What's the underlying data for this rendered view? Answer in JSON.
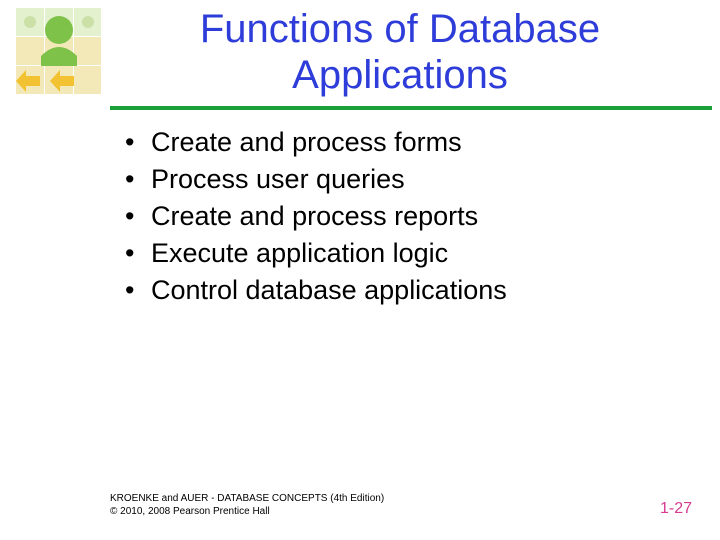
{
  "title": "Functions of Database Applications",
  "bullets": {
    "b0": "Create and process forms",
    "b1": "Process user queries",
    "b2": "Create and process reports",
    "b3": "Execute application logic",
    "b4": "Control database applications"
  },
  "footer": {
    "line1": "KROENKE and AUER - DATABASE CONCEPTS (4th Edition)",
    "line2": "© 2010, 2008 Pearson Prentice Hall"
  },
  "page_number": "1-27"
}
